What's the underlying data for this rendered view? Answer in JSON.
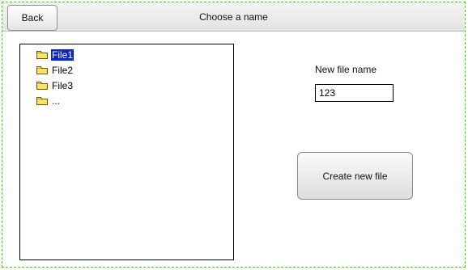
{
  "header": {
    "title": "Choose a name",
    "back_label": "Back"
  },
  "file_tree": {
    "items": [
      {
        "label": "File1",
        "icon": "folder-icon",
        "selected": true
      },
      {
        "label": "File2",
        "icon": "folder-icon",
        "selected": false
      },
      {
        "label": "File3",
        "icon": "folder-icon",
        "selected": false
      },
      {
        "label": "...",
        "icon": "folder-icon",
        "selected": false
      }
    ]
  },
  "form": {
    "new_file_label": "New file name",
    "new_file_value": "123",
    "create_label": "Create new file"
  },
  "colors": {
    "selection": "#0a24c8",
    "folder_fill": "#f7e36b",
    "folder_stroke": "#6b5a00",
    "frame_border": "#5bbf3a"
  }
}
